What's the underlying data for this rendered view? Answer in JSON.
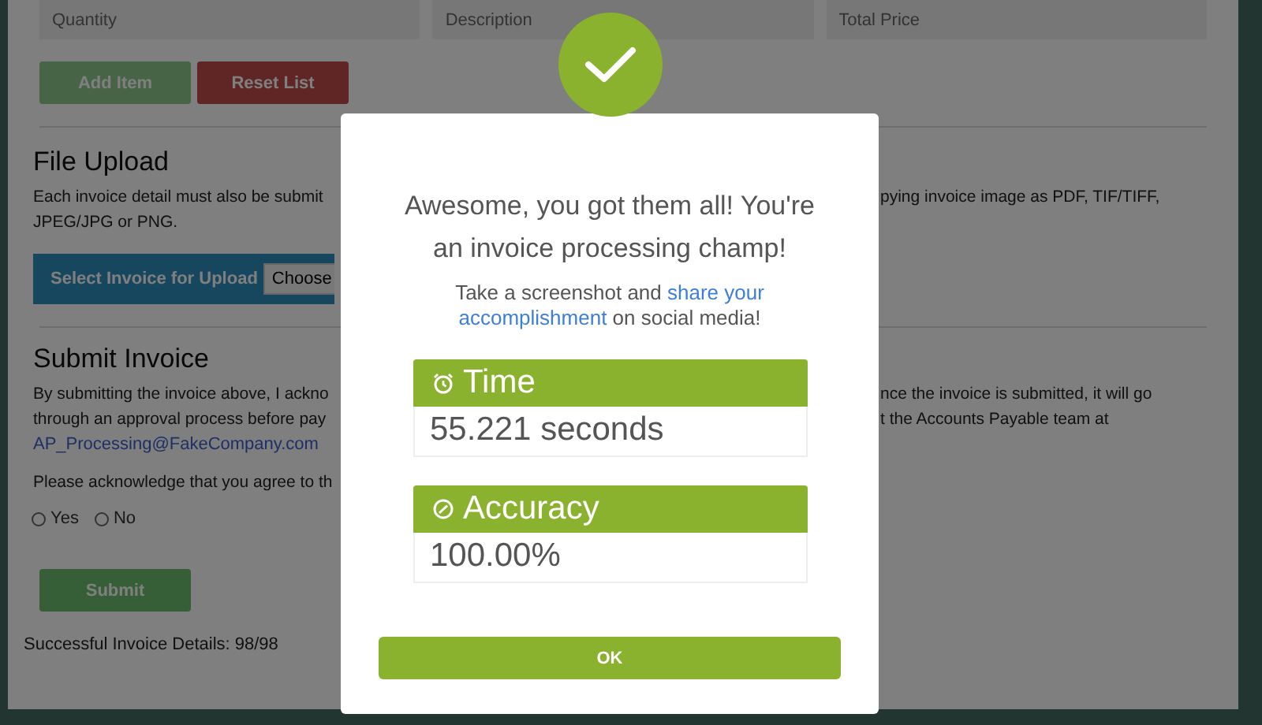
{
  "fields": [
    {
      "placeholder": "Quantity"
    },
    {
      "placeholder": "Description"
    },
    {
      "placeholder": "Total Price"
    }
  ],
  "list_buttons": [
    {
      "label": "Add Item",
      "kind": "add"
    },
    {
      "label": "Reset List",
      "kind": "reset"
    }
  ],
  "file_upload": {
    "heading": "File Upload",
    "lines": [
      {
        "left": "Each invoice detail must also be submit",
        "right": "pying invoice image as PDF, TIF/TIFF,"
      },
      {
        "left": "JPEG/JPG or PNG."
      }
    ],
    "select_label": "Select Invoice for Upload",
    "choose": "Choose"
  },
  "submit_invoice": {
    "heading": "Submit Invoice",
    "lines": [
      {
        "left": "By submitting the invoice above, I ackno",
        "right": "nce the invoice is submitted, it will go"
      },
      {
        "left": "through an approval process before pay",
        "right": "t the Accounts Payable team at"
      }
    ],
    "email": "AP_Processing@FakeCompany.com",
    "acknowledge": "Please acknowledge that you agree to th",
    "options": [
      {
        "label": "Yes",
        "selected": false
      },
      {
        "label": "No",
        "selected": false
      }
    ],
    "submit": {
      "label": "Submit",
      "disabled": true
    }
  },
  "status": "Successful Invoice Details: 98/98",
  "modal": {
    "title": "Awesome, you got them all! You're an invoice processing champ!",
    "text_before": "Take a screenshot and ",
    "link": [
      "share your",
      "accomplishment"
    ],
    "text_after": " on social media!",
    "stats": [
      {
        "label": "Time",
        "kind": "time",
        "value": "55.221 seconds"
      },
      {
        "label": "Accuracy",
        "kind": "accuracy",
        "value": "100.00%"
      }
    ],
    "ok": "OK"
  }
}
